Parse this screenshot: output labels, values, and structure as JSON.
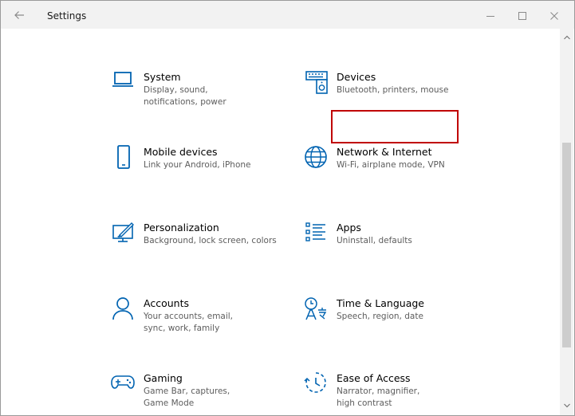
{
  "window": {
    "title": "Settings",
    "back_icon": "back-arrow-icon",
    "controls": [
      "minimize-icon",
      "maximize-icon",
      "close-icon"
    ]
  },
  "accent_color": "#0063b1",
  "items": [
    {
      "title": "System",
      "desc": "Display, sound, notifications, power",
      "icon": "laptop-icon"
    },
    {
      "title": "Devices",
      "desc": "Bluetooth, printers, mouse",
      "icon": "keyboard-speaker-icon"
    },
    {
      "title": "Mobile devices",
      "desc": "Link your Android, iPhone",
      "icon": "phone-icon"
    },
    {
      "title": "Network & Internet",
      "desc": "Wi-Fi, airplane mode, VPN",
      "icon": "globe-icon",
      "highlighted": true
    },
    {
      "title": "Personalization",
      "desc": "Background, lock screen, colors",
      "icon": "paint-screen-icon"
    },
    {
      "title": "Apps",
      "desc": "Uninstall, defaults",
      "icon": "apps-list-icon"
    },
    {
      "title": "Accounts",
      "desc": "Your accounts, email, sync, work, family",
      "icon": "person-icon"
    },
    {
      "title": "Time & Language",
      "desc": "Speech, region, date",
      "icon": "time-language-icon"
    },
    {
      "title": "Gaming",
      "desc": "Game Bar, captures, Game Mode",
      "icon": "gamepad-icon"
    },
    {
      "title": "Ease of Access",
      "desc": "Narrator, magnifier, high contrast",
      "icon": "ease-of-access-icon"
    }
  ]
}
